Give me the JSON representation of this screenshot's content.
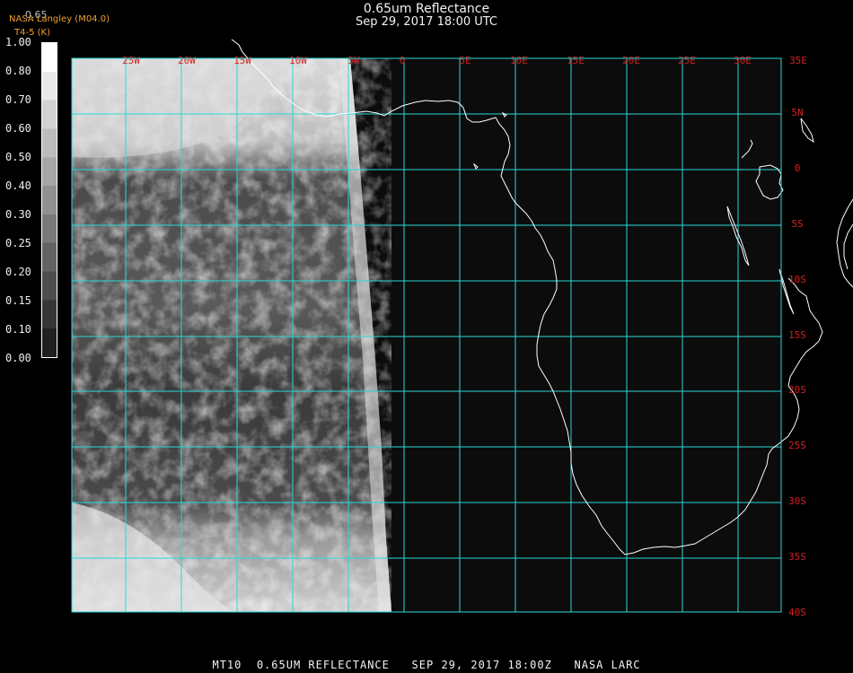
{
  "header": {
    "title": "0.65um Reflectance",
    "subtitle": "Sep 29, 2017 18:00 UTC",
    "org_line1": "NASA Langley (M04.0)",
    "org_line2": "T4-5 (K)",
    "ghost_value": "0.65"
  },
  "colorbar": {
    "labels": [
      "1.00",
      "0.80",
      "0.70",
      "0.60",
      "0.50",
      "0.40",
      "0.30",
      "0.25",
      "0.20",
      "0.15",
      "0.10",
      "0.00"
    ]
  },
  "map": {
    "grid_color": "#2ad8d8",
    "coast_color": "#ffffff",
    "label_color": "#d22020",
    "longitude_labels": [
      "25W",
      "20W",
      "15W",
      "10W",
      "5W",
      "0",
      "5E",
      "10E",
      "15E",
      "20E",
      "25E",
      "30E",
      "35E"
    ],
    "latitude_labels": [
      "5N",
      "0",
      "5S",
      "10S",
      "15S",
      "20S",
      "25S",
      "30S",
      "35S",
      "40S"
    ]
  },
  "footer": {
    "text": "MT10  0.65UM REFLECTANCE   SEP 29, 2017 18:00Z   NASA LARC"
  }
}
